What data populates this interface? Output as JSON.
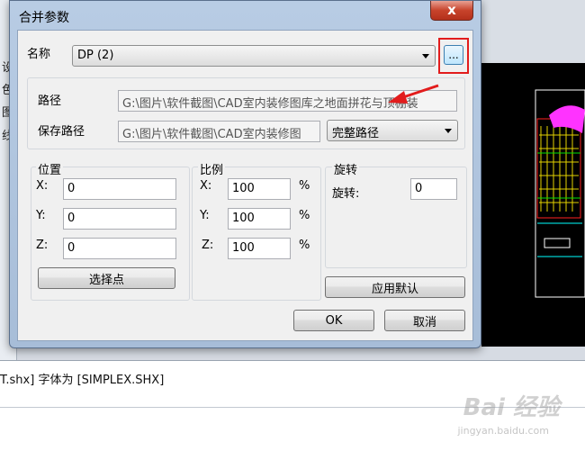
{
  "background": {
    "side_chars": [
      "设",
      "色",
      "图",
      "线"
    ],
    "command_line": "T.shx] 字体为 [SIMPLEX.SHX]",
    "watermark": "Bai 经验",
    "watermark_sub": "jingyan.baidu.com"
  },
  "dialog": {
    "title": "合并参数",
    "close_glyph": "x",
    "name_label": "名称",
    "name_value": "DP (2)",
    "browse_label": "...",
    "path_label": "路径",
    "path_value": "G:\\图片\\软件截图\\CAD室内装修图库之地面拼花与顶棚装",
    "save_path_label": "保存路径",
    "save_path_value": "G:\\图片\\软件截图\\CAD室内装修图",
    "save_path_mode": "完整路径",
    "position": {
      "title": "位置",
      "x_label": "X:",
      "x_value": "0",
      "y_label": "Y:",
      "y_value": "0",
      "z_label": "Z:",
      "z_value": "0",
      "pick_button": "选择点"
    },
    "scale": {
      "title": "比例",
      "x_label": "X:",
      "x_value": "100",
      "y_label": "Y:",
      "y_value": "100",
      "z_label": "Z:",
      "z_value": "100",
      "unit": "%"
    },
    "rotation": {
      "title": "旋转",
      "label": "旋转:",
      "value": "0",
      "apply_default_button": "应用默认"
    },
    "ok_button": "OK",
    "cancel_button": "取消"
  },
  "colors": {
    "highlight_red": "#e21c1c",
    "dialog_frame": "#b8cce4"
  }
}
